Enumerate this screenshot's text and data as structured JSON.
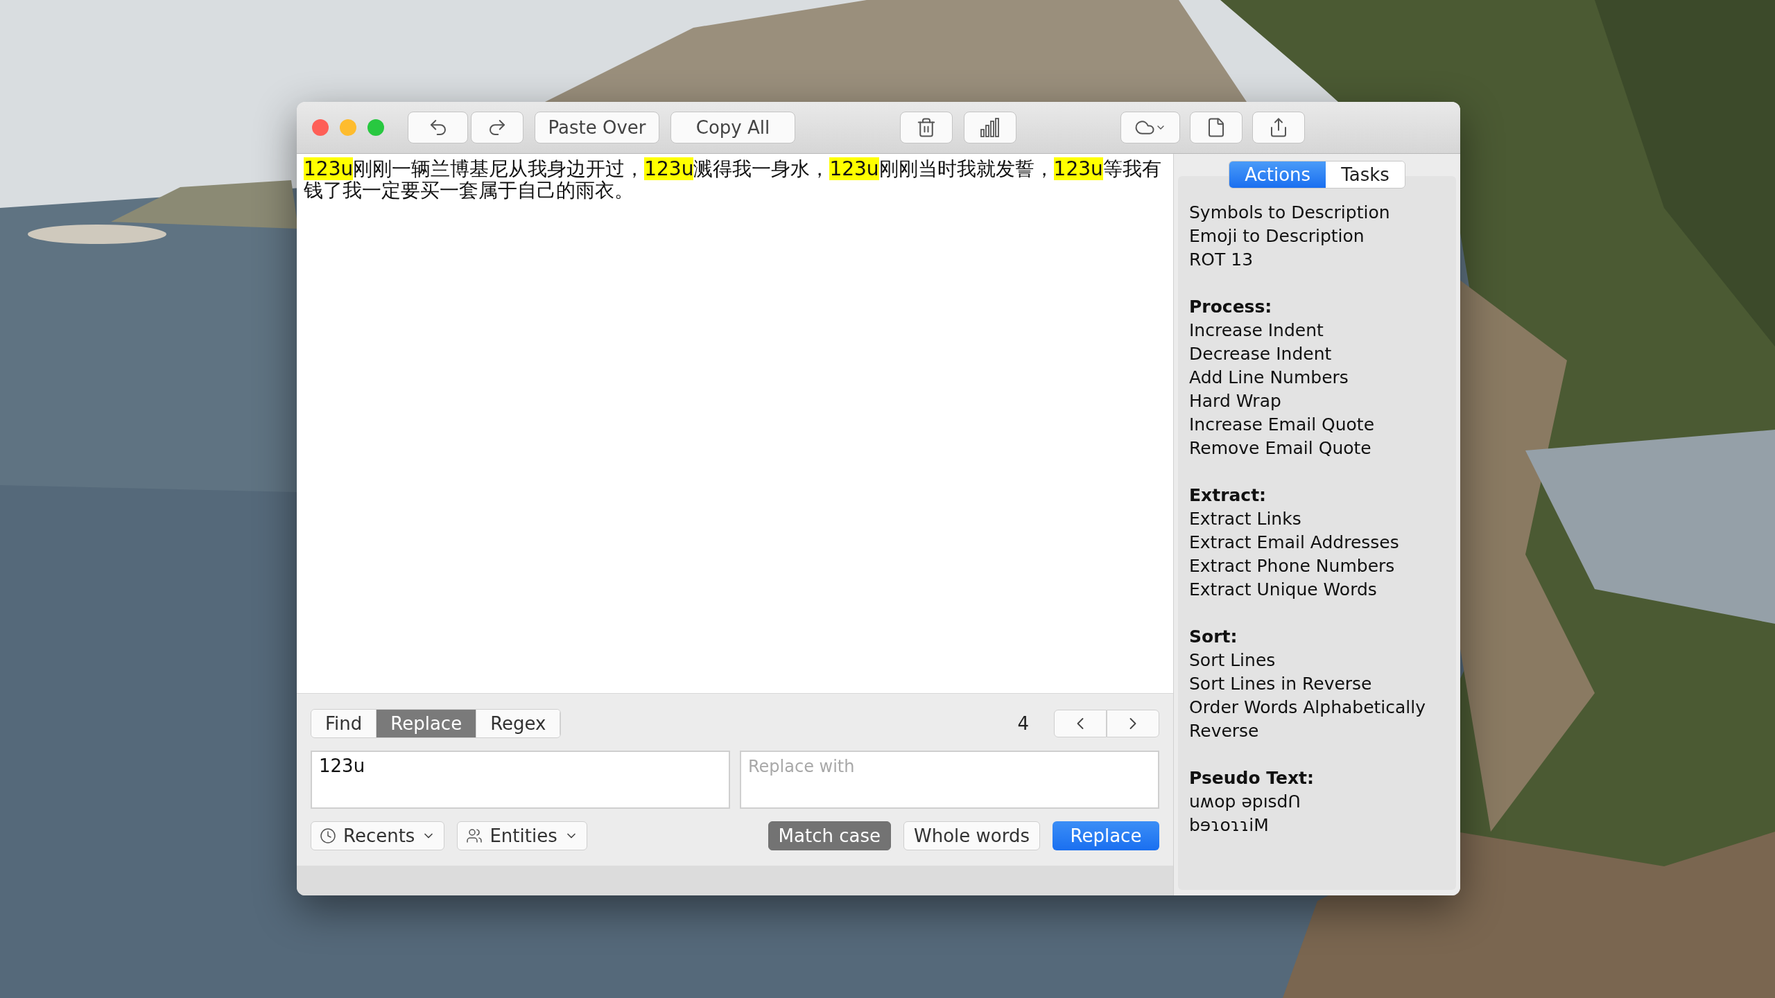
{
  "toolbar": {
    "buttons": [
      {
        "kind": "undo"
      },
      {
        "kind": "redo"
      },
      {
        "kind": "text",
        "label": "Paste Over"
      },
      {
        "kind": "text",
        "label": "Copy All"
      },
      {
        "kind": "trash"
      },
      {
        "kind": "stats"
      },
      {
        "kind": "cloud"
      },
      {
        "kind": "document"
      },
      {
        "kind": "share"
      }
    ]
  },
  "editor": {
    "segments": [
      {
        "text": "123u",
        "highlighted": true
      },
      {
        "text": "刚刚一辆兰博基尼从我身边开过，",
        "highlighted": false
      },
      {
        "text": "123u",
        "highlighted": true
      },
      {
        "text": "溅得我一身水，",
        "highlighted": false
      },
      {
        "text": "123u",
        "highlighted": true
      },
      {
        "text": "刚刚当时我就发誓，",
        "highlighted": false
      },
      {
        "text": "123u",
        "highlighted": true
      },
      {
        "text": "等我有钱了我一定要买一套属于自己的雨衣。",
        "highlighted": false
      }
    ]
  },
  "find_panel": {
    "tabs": [
      {
        "label": "Find",
        "selected": false
      },
      {
        "label": "Replace",
        "selected": true
      },
      {
        "label": "Regex",
        "selected": false
      }
    ],
    "match_count": "4",
    "find_field": {
      "value": "123u"
    },
    "replace_field": {
      "placeholder": "Replace with"
    },
    "menus": [
      {
        "kind": "recents",
        "label": "Recents"
      },
      {
        "kind": "entities",
        "label": "Entities"
      }
    ],
    "options": [
      {
        "label": "Match case",
        "on": true
      },
      {
        "label": "Whole words",
        "on": false
      }
    ],
    "action_button": "Replace"
  },
  "sidebar": {
    "tabs": [
      {
        "label": "Actions",
        "selected": true
      },
      {
        "label": "Tasks",
        "selected": false
      }
    ],
    "sections": [
      {
        "items": [
          "Symbols to Description",
          "Emoji to Description",
          "ROT 13"
        ]
      },
      {
        "heading": "Process:",
        "items": [
          "Increase Indent",
          "Decrease Indent",
          "Add Line Numbers",
          "Hard Wrap",
          "Increase Email Quote",
          "Remove Email Quote"
        ]
      },
      {
        "heading": "Extract:",
        "items": [
          "Extract Links",
          "Extract Email Addresses",
          "Extract Phone Numbers",
          "Extract Unique Words"
        ]
      },
      {
        "heading": "Sort:",
        "items": [
          "Sort Lines",
          "Sort Lines in Reverse",
          "Order Words Alphabetically",
          "Reverse"
        ]
      },
      {
        "heading": "Pseudo Text:",
        "items": [
          "uʍop ǝpısdՈ",
          "bɘɿoɿɿiM"
        ]
      }
    ]
  }
}
